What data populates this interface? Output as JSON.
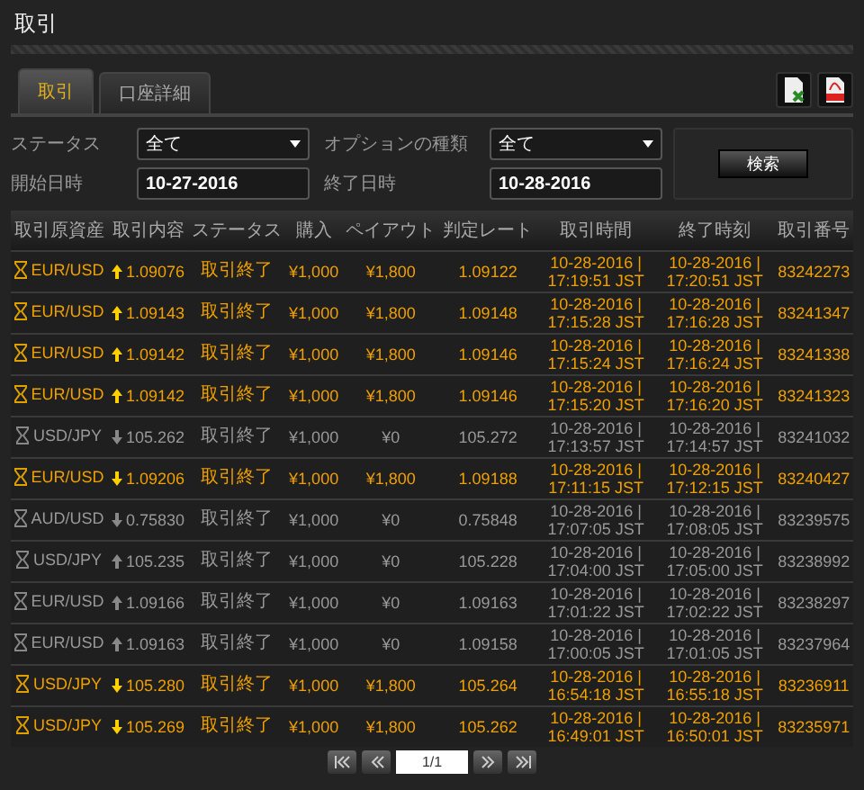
{
  "page_title": "取引",
  "tabs": [
    {
      "label": "取引",
      "selected": true
    },
    {
      "label": "口座詳細",
      "selected": false
    }
  ],
  "filters": [
    {
      "label": "ステータス",
      "kind": "select",
      "value": "全て"
    },
    {
      "label": "オプションの種類",
      "kind": "select",
      "value": "全て"
    },
    {
      "label": "開始日時",
      "kind": "text",
      "value": "10-27-2016"
    },
    {
      "label": "終了日時",
      "kind": "text",
      "value": "10-28-2016"
    }
  ],
  "search_button": "検索",
  "table": {
    "columns": [
      "取引原資産",
      "取引内容",
      "ステータス",
      "購入",
      "ペイアウト",
      "判定レート",
      "取引時間",
      "終了時刻",
      "取引番号"
    ],
    "rows": [
      {
        "won": true,
        "up": true,
        "asset": "EUR/USD",
        "strike": "1.09076",
        "status": "取引終了",
        "purchase": "¥1,000",
        "payout": "¥1,800",
        "rate": "1.09122",
        "trade_time": "10-28-2016 | 17:19:51 JST",
        "end_time": "10-28-2016 | 17:20:51 JST",
        "id": "83242273"
      },
      {
        "won": true,
        "up": true,
        "asset": "EUR/USD",
        "strike": "1.09143",
        "status": "取引終了",
        "purchase": "¥1,000",
        "payout": "¥1,800",
        "rate": "1.09148",
        "trade_time": "10-28-2016 | 17:15:28 JST",
        "end_time": "10-28-2016 | 17:16:28 JST",
        "id": "83241347"
      },
      {
        "won": true,
        "up": true,
        "asset": "EUR/USD",
        "strike": "1.09142",
        "status": "取引終了",
        "purchase": "¥1,000",
        "payout": "¥1,800",
        "rate": "1.09146",
        "trade_time": "10-28-2016 | 17:15:24 JST",
        "end_time": "10-28-2016 | 17:16:24 JST",
        "id": "83241338"
      },
      {
        "won": true,
        "up": true,
        "asset": "EUR/USD",
        "strike": "1.09142",
        "status": "取引終了",
        "purchase": "¥1,000",
        "payout": "¥1,800",
        "rate": "1.09146",
        "trade_time": "10-28-2016 | 17:15:20 JST",
        "end_time": "10-28-2016 | 17:16:20 JST",
        "id": "83241323"
      },
      {
        "won": false,
        "up": false,
        "asset": "USD/JPY",
        "strike": "105.262",
        "status": "取引終了",
        "purchase": "¥1,000",
        "payout": "¥0",
        "rate": "105.272",
        "trade_time": "10-28-2016 | 17:13:57 JST",
        "end_time": "10-28-2016 | 17:14:57 JST",
        "id": "83241032"
      },
      {
        "won": true,
        "up": false,
        "asset": "EUR/USD",
        "strike": "1.09206",
        "status": "取引終了",
        "purchase": "¥1,000",
        "payout": "¥1,800",
        "rate": "1.09188",
        "trade_time": "10-28-2016 | 17:11:15 JST",
        "end_time": "10-28-2016 | 17:12:15 JST",
        "id": "83240427"
      },
      {
        "won": false,
        "up": false,
        "asset": "AUD/USD",
        "strike": "0.75830",
        "status": "取引終了",
        "purchase": "¥1,000",
        "payout": "¥0",
        "rate": "0.75848",
        "trade_time": "10-28-2016 | 17:07:05 JST",
        "end_time": "10-28-2016 | 17:08:05 JST",
        "id": "83239575"
      },
      {
        "won": false,
        "up": true,
        "asset": "USD/JPY",
        "strike": "105.235",
        "status": "取引終了",
        "purchase": "¥1,000",
        "payout": "¥0",
        "rate": "105.228",
        "trade_time": "10-28-2016 | 17:04:00 JST",
        "end_time": "10-28-2016 | 17:05:00 JST",
        "id": "83238992"
      },
      {
        "won": false,
        "up": true,
        "asset": "EUR/USD",
        "strike": "1.09166",
        "status": "取引終了",
        "purchase": "¥1,000",
        "payout": "¥0",
        "rate": "1.09163",
        "trade_time": "10-28-2016 | 17:01:22 JST",
        "end_time": "10-28-2016 | 17:02:22 JST",
        "id": "83238297"
      },
      {
        "won": false,
        "up": true,
        "asset": "EUR/USD",
        "strike": "1.09163",
        "status": "取引終了",
        "purchase": "¥1,000",
        "payout": "¥0",
        "rate": "1.09158",
        "trade_time": "10-28-2016 | 17:00:05 JST",
        "end_time": "10-28-2016 | 17:01:05 JST",
        "id": "83237964"
      },
      {
        "won": true,
        "up": false,
        "asset": "USD/JPY",
        "strike": "105.280",
        "status": "取引終了",
        "purchase": "¥1,000",
        "payout": "¥1,800",
        "rate": "105.264",
        "trade_time": "10-28-2016 | 16:54:18 JST",
        "end_time": "10-28-2016 | 16:55:18 JST",
        "id": "83236911"
      },
      {
        "won": true,
        "up": false,
        "asset": "USD/JPY",
        "strike": "105.269",
        "status": "取引終了",
        "purchase": "¥1,000",
        "payout": "¥1,800",
        "rate": "105.262",
        "trade_time": "10-28-2016 | 16:49:01 JST",
        "end_time": "10-28-2016 | 16:50:01 JST",
        "id": "83235971"
      }
    ]
  },
  "pagination": {
    "page": "1/1"
  }
}
